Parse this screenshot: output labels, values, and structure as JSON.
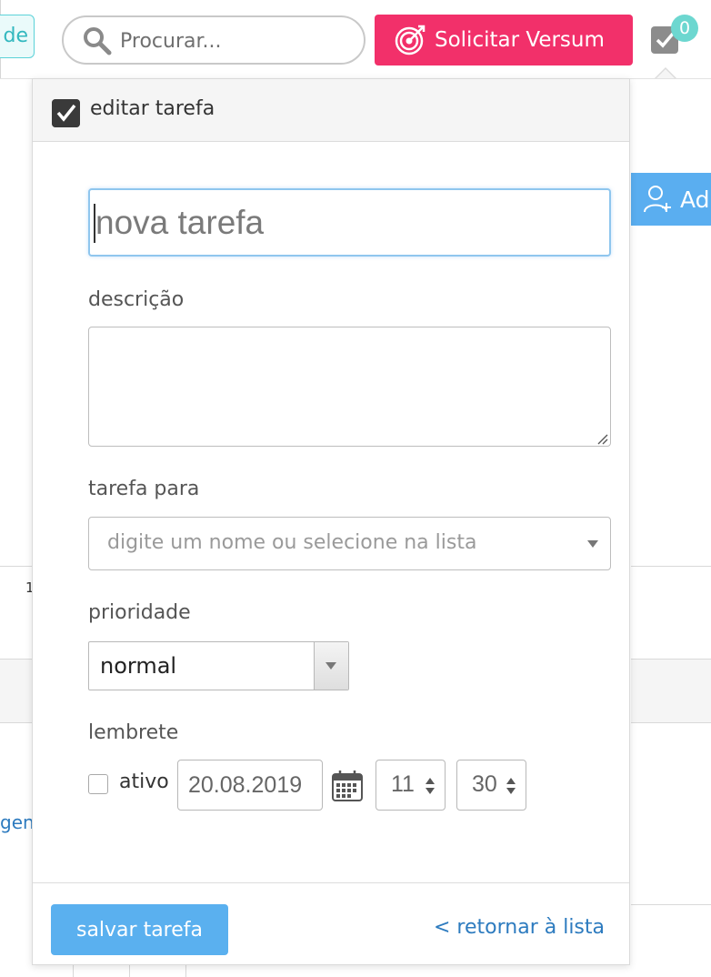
{
  "topbar": {
    "left_pill_label": "de",
    "search": {
      "placeholder": "Procurar..."
    },
    "cta_label": "Solicitar Versum",
    "tasks_count": "0"
  },
  "background": {
    "add_button_label": "Ad",
    "row_label": "1",
    "link_fragment": "gen"
  },
  "panel": {
    "title": "editar tarefa",
    "task_name_placeholder": "nova tarefa",
    "description_label": "descrição",
    "assignee_label": "tarefa para",
    "assignee_placeholder": "digite um nome ou selecione na lista",
    "priority_label": "prioridade",
    "priority_value": "normal",
    "reminder_label": "lembrete",
    "reminder_active_label": "ativo",
    "reminder_date": "20.08.2019",
    "reminder_hour": "11",
    "reminder_minute": "30",
    "save_label": "salvar tarefa",
    "back_label": "< retornar à lista"
  },
  "colors": {
    "accent_pink": "#f2306a",
    "accent_blue": "#5ab0ef",
    "link_blue": "#2d7bbf",
    "badge_teal": "#6dd7d0"
  }
}
